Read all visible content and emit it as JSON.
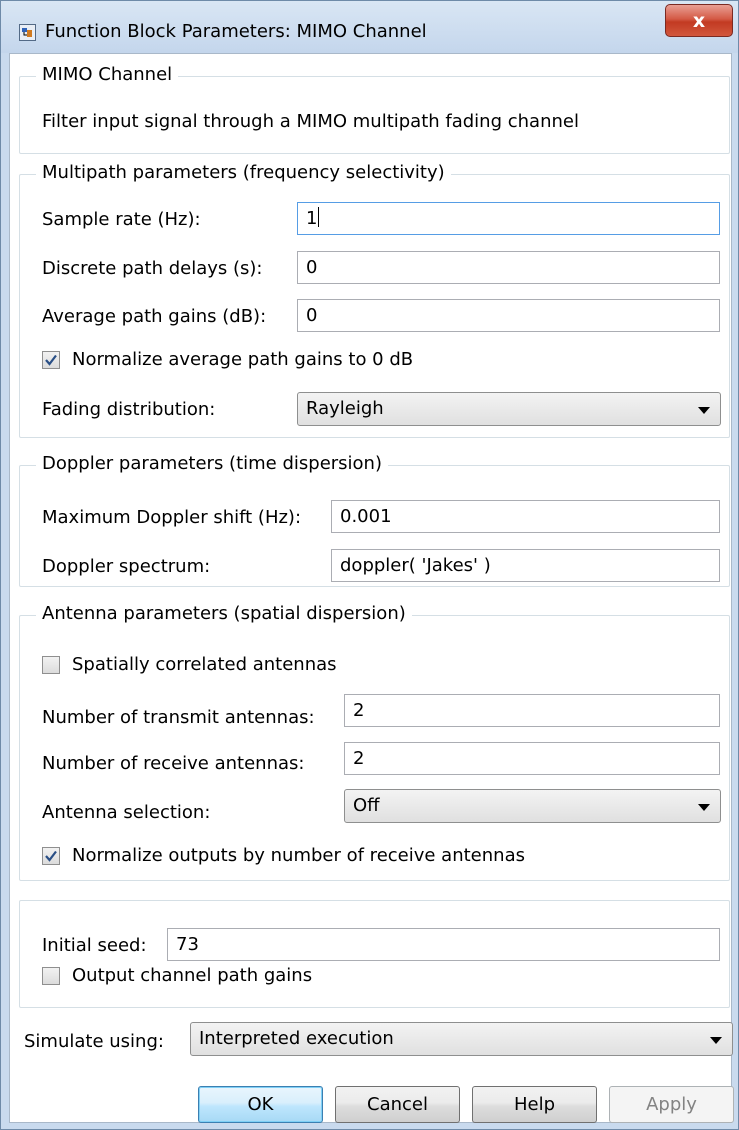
{
  "window": {
    "title": "Function Block Parameters: MIMO Channel",
    "close_glyph": "x"
  },
  "block": {
    "name": "MIMO Channel",
    "description": "Filter input signal through a MIMO multipath fading channel"
  },
  "multipath": {
    "title": "Multipath parameters (frequency selectivity)",
    "sample_rate_label": "Sample rate (Hz):",
    "sample_rate_value": "1",
    "path_delays_label": "Discrete path delays (s):",
    "path_delays_value": "0",
    "path_gains_label": "Average path gains (dB):",
    "path_gains_value": "0",
    "normalize_gains_label": "Normalize average path gains to 0 dB",
    "normalize_gains_checked": true,
    "fading_label": "Fading distribution:",
    "fading_value": "Rayleigh"
  },
  "doppler": {
    "title": "Doppler parameters (time dispersion)",
    "max_shift_label": "Maximum Doppler shift (Hz):",
    "max_shift_value": "0.001",
    "spectrum_label": "Doppler spectrum:",
    "spectrum_value": "doppler( 'Jakes' )"
  },
  "antenna": {
    "title": "Antenna parameters (spatial dispersion)",
    "spatially_correlated_label": "Spatially correlated antennas",
    "spatially_correlated_checked": false,
    "transmit_label": "Number of transmit antennas:",
    "transmit_value": "2",
    "receive_label": "Number of receive antennas:",
    "receive_value": "2",
    "selection_label": "Antenna selection:",
    "selection_value": "Off",
    "normalize_outputs_label": "Normalize outputs by number of receive antennas",
    "normalize_outputs_checked": true
  },
  "seed": {
    "initial_seed_label": "Initial seed:",
    "initial_seed_value": "73",
    "output_path_gains_label": "Output channel path gains",
    "output_path_gains_checked": false
  },
  "simulate": {
    "label": "Simulate using:",
    "value": "Interpreted execution"
  },
  "buttons": {
    "ok": "OK",
    "cancel": "Cancel",
    "help": "Help",
    "apply": "Apply"
  },
  "colors": {
    "accent": "#3c7fb1",
    "close_red": "#c23a22",
    "group_border": "#d5dfe5"
  }
}
